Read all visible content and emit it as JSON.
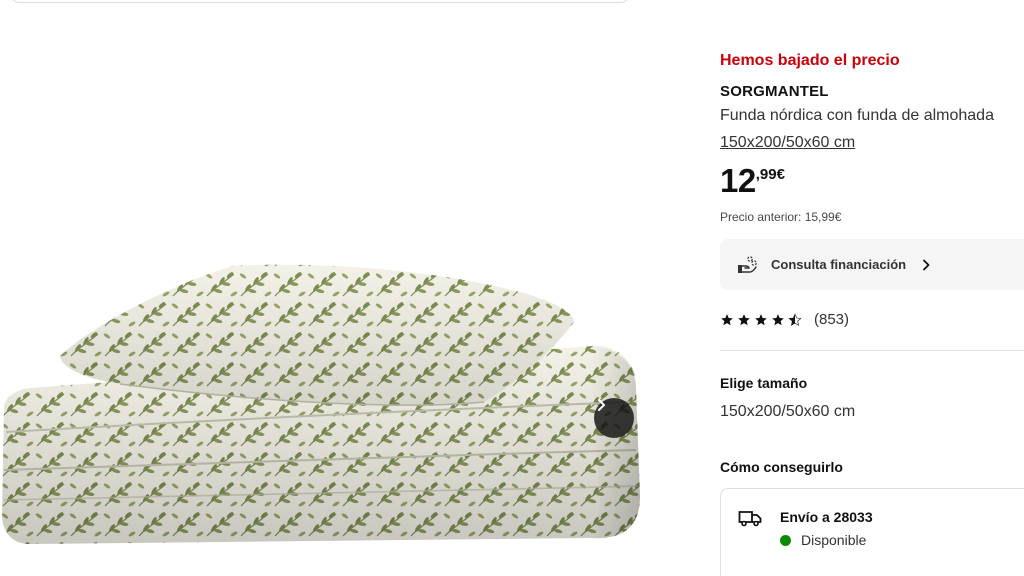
{
  "product": {
    "promo_label": "Hemos bajado el precio",
    "name": "SORGMANTEL",
    "description": "Funda nórdica con funda de almohada",
    "size_link": "150x200/50x60 cm",
    "price_integer": "12",
    "price_decimal": ",99",
    "price_currency": "€",
    "previous_price": "Precio anterior: 15,99€"
  },
  "financing": {
    "label": "Consulta financiación",
    "icon": "hand-coins-icon"
  },
  "rating": {
    "stars": 4.5,
    "count": "(853)"
  },
  "size_selector": {
    "title": "Elige tamaño",
    "value": "150x200/50x60 cm"
  },
  "fulfillment": {
    "title": "Cómo conseguirlo",
    "delivery_title": "Envío a 28033",
    "delivery_status": "Disponible",
    "status_color": "#0a8a00"
  },
  "gallery": {
    "next_icon": "chevron-right-icon"
  },
  "colors": {
    "promo_red": "#cc0008",
    "leaf_green": "#7e8f52"
  }
}
